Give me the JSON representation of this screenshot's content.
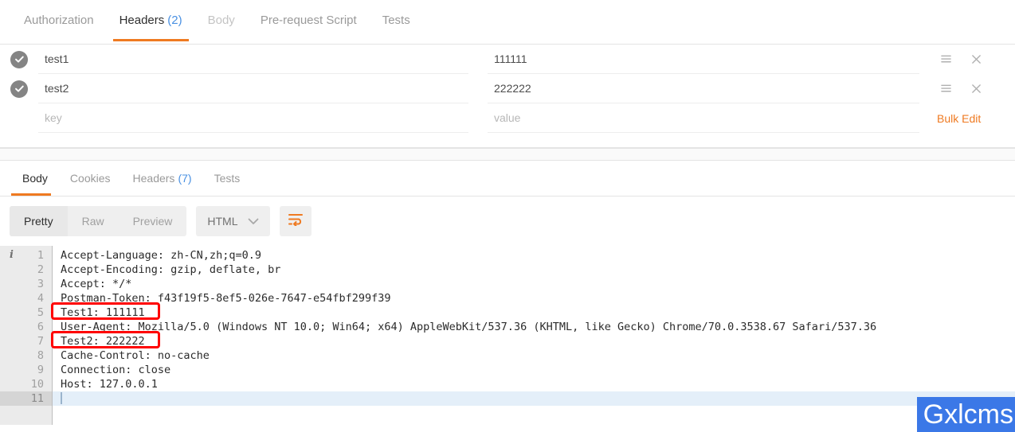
{
  "request_tabs": [
    {
      "label": "Authorization",
      "count": "",
      "state": "normal"
    },
    {
      "label": "Headers",
      "count": "(2)",
      "state": "active"
    },
    {
      "label": "Body",
      "count": "",
      "state": "disabled"
    },
    {
      "label": "Pre-request Script",
      "count": "",
      "state": "normal"
    },
    {
      "label": "Tests",
      "count": "",
      "state": "normal"
    }
  ],
  "headers_table": {
    "rows": [
      {
        "key": "test1",
        "value": "111111",
        "checked": true,
        "placeholder": false
      },
      {
        "key": "test2",
        "value": "222222",
        "checked": true,
        "placeholder": false
      }
    ],
    "new_row": {
      "key_placeholder": "key",
      "value_placeholder": "value"
    },
    "bulk_edit_label": "Bulk Edit"
  },
  "response_tabs": [
    {
      "label": "Body",
      "count": "",
      "state": "active"
    },
    {
      "label": "Cookies",
      "count": "",
      "state": "normal"
    },
    {
      "label": "Headers",
      "count": "(7)",
      "state": "normal"
    },
    {
      "label": "Tests",
      "count": "",
      "state": "normal"
    }
  ],
  "body_toolbar": {
    "view_modes": [
      {
        "label": "Pretty",
        "active": true
      },
      {
        "label": "Raw",
        "active": false
      },
      {
        "label": "Preview",
        "active": false
      }
    ],
    "format_selected": "HTML",
    "wrap_button": "word-wrap-toggle"
  },
  "code_viewer": {
    "lines": [
      {
        "num": "1",
        "text": "Accept-Language: zh-CN,zh;q=0.9"
      },
      {
        "num": "2",
        "text": "Accept-Encoding: gzip, deflate, br"
      },
      {
        "num": "3",
        "text": "Accept: */*"
      },
      {
        "num": "4",
        "text": "Postman-Token: f43f19f5-8ef5-026e-7647-e54fbf299f39"
      },
      {
        "num": "5",
        "text": "Test1: 111111"
      },
      {
        "num": "6",
        "text": "User-Agent: Mozilla/5.0 (Windows NT 10.0; Win64; x64) AppleWebKit/537.36 (KHTML, like Gecko) Chrome/70.0.3538.67 Safari/537.36"
      },
      {
        "num": "7",
        "text": "Test2: 222222"
      },
      {
        "num": "8",
        "text": "Cache-Control: no-cache"
      },
      {
        "num": "9",
        "text": "Connection: close"
      },
      {
        "num": "10",
        "text": "Host: 127.0.0.1"
      },
      {
        "num": "11",
        "text": ""
      }
    ],
    "active_line": "11",
    "info_marker_line": "1"
  },
  "annotations": {
    "highlight_boxes": [
      {
        "target_line": "5",
        "text": "Test1: 111111"
      },
      {
        "target_line": "7",
        "text": "Test2: 222222"
      }
    ]
  },
  "watermark": {
    "text": "Gxlcms"
  },
  "colors": {
    "accent_orange": "#ef7a21",
    "count_blue": "#4990e2",
    "annotation_red": "#ff0000",
    "watermark_blue": "#3b78e7",
    "active_line_blue": "#e4eff9"
  }
}
